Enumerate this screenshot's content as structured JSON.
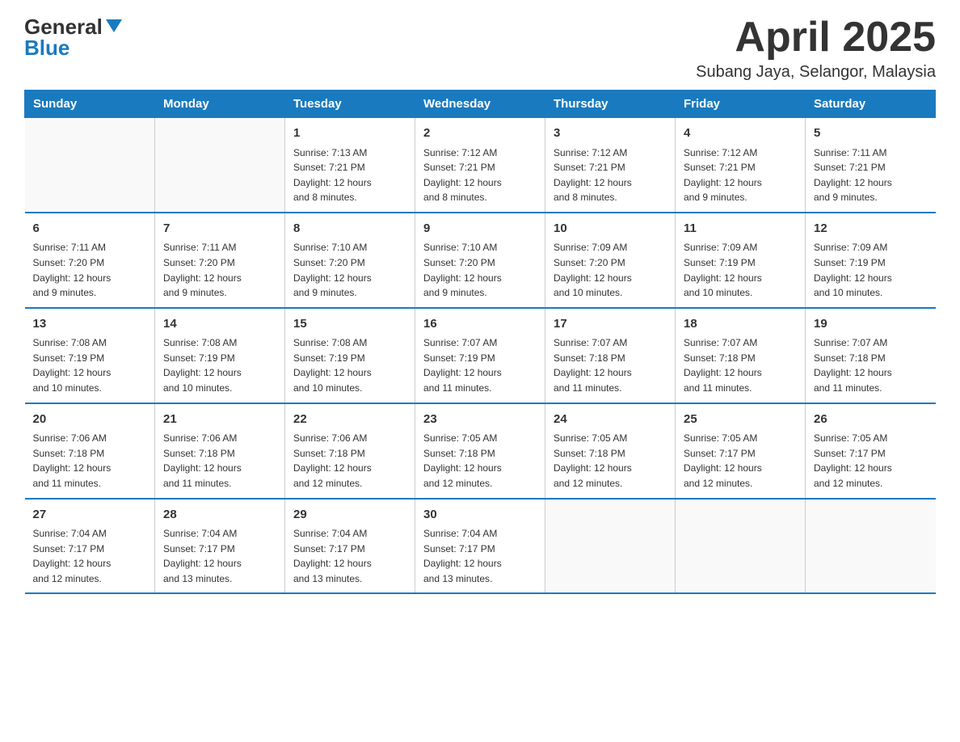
{
  "header": {
    "logo_general": "General",
    "logo_blue": "Blue",
    "month_title": "April 2025",
    "location": "Subang Jaya, Selangor, Malaysia"
  },
  "weekdays": [
    "Sunday",
    "Monday",
    "Tuesday",
    "Wednesday",
    "Thursday",
    "Friday",
    "Saturday"
  ],
  "weeks": [
    [
      {
        "day": "",
        "info": ""
      },
      {
        "day": "",
        "info": ""
      },
      {
        "day": "1",
        "info": "Sunrise: 7:13 AM\nSunset: 7:21 PM\nDaylight: 12 hours\nand 8 minutes."
      },
      {
        "day": "2",
        "info": "Sunrise: 7:12 AM\nSunset: 7:21 PM\nDaylight: 12 hours\nand 8 minutes."
      },
      {
        "day": "3",
        "info": "Sunrise: 7:12 AM\nSunset: 7:21 PM\nDaylight: 12 hours\nand 8 minutes."
      },
      {
        "day": "4",
        "info": "Sunrise: 7:12 AM\nSunset: 7:21 PM\nDaylight: 12 hours\nand 9 minutes."
      },
      {
        "day": "5",
        "info": "Sunrise: 7:11 AM\nSunset: 7:21 PM\nDaylight: 12 hours\nand 9 minutes."
      }
    ],
    [
      {
        "day": "6",
        "info": "Sunrise: 7:11 AM\nSunset: 7:20 PM\nDaylight: 12 hours\nand 9 minutes."
      },
      {
        "day": "7",
        "info": "Sunrise: 7:11 AM\nSunset: 7:20 PM\nDaylight: 12 hours\nand 9 minutes."
      },
      {
        "day": "8",
        "info": "Sunrise: 7:10 AM\nSunset: 7:20 PM\nDaylight: 12 hours\nand 9 minutes."
      },
      {
        "day": "9",
        "info": "Sunrise: 7:10 AM\nSunset: 7:20 PM\nDaylight: 12 hours\nand 9 minutes."
      },
      {
        "day": "10",
        "info": "Sunrise: 7:09 AM\nSunset: 7:20 PM\nDaylight: 12 hours\nand 10 minutes."
      },
      {
        "day": "11",
        "info": "Sunrise: 7:09 AM\nSunset: 7:19 PM\nDaylight: 12 hours\nand 10 minutes."
      },
      {
        "day": "12",
        "info": "Sunrise: 7:09 AM\nSunset: 7:19 PM\nDaylight: 12 hours\nand 10 minutes."
      }
    ],
    [
      {
        "day": "13",
        "info": "Sunrise: 7:08 AM\nSunset: 7:19 PM\nDaylight: 12 hours\nand 10 minutes."
      },
      {
        "day": "14",
        "info": "Sunrise: 7:08 AM\nSunset: 7:19 PM\nDaylight: 12 hours\nand 10 minutes."
      },
      {
        "day": "15",
        "info": "Sunrise: 7:08 AM\nSunset: 7:19 PM\nDaylight: 12 hours\nand 10 minutes."
      },
      {
        "day": "16",
        "info": "Sunrise: 7:07 AM\nSunset: 7:19 PM\nDaylight: 12 hours\nand 11 minutes."
      },
      {
        "day": "17",
        "info": "Sunrise: 7:07 AM\nSunset: 7:18 PM\nDaylight: 12 hours\nand 11 minutes."
      },
      {
        "day": "18",
        "info": "Sunrise: 7:07 AM\nSunset: 7:18 PM\nDaylight: 12 hours\nand 11 minutes."
      },
      {
        "day": "19",
        "info": "Sunrise: 7:07 AM\nSunset: 7:18 PM\nDaylight: 12 hours\nand 11 minutes."
      }
    ],
    [
      {
        "day": "20",
        "info": "Sunrise: 7:06 AM\nSunset: 7:18 PM\nDaylight: 12 hours\nand 11 minutes."
      },
      {
        "day": "21",
        "info": "Sunrise: 7:06 AM\nSunset: 7:18 PM\nDaylight: 12 hours\nand 11 minutes."
      },
      {
        "day": "22",
        "info": "Sunrise: 7:06 AM\nSunset: 7:18 PM\nDaylight: 12 hours\nand 12 minutes."
      },
      {
        "day": "23",
        "info": "Sunrise: 7:05 AM\nSunset: 7:18 PM\nDaylight: 12 hours\nand 12 minutes."
      },
      {
        "day": "24",
        "info": "Sunrise: 7:05 AM\nSunset: 7:18 PM\nDaylight: 12 hours\nand 12 minutes."
      },
      {
        "day": "25",
        "info": "Sunrise: 7:05 AM\nSunset: 7:17 PM\nDaylight: 12 hours\nand 12 minutes."
      },
      {
        "day": "26",
        "info": "Sunrise: 7:05 AM\nSunset: 7:17 PM\nDaylight: 12 hours\nand 12 minutes."
      }
    ],
    [
      {
        "day": "27",
        "info": "Sunrise: 7:04 AM\nSunset: 7:17 PM\nDaylight: 12 hours\nand 12 minutes."
      },
      {
        "day": "28",
        "info": "Sunrise: 7:04 AM\nSunset: 7:17 PM\nDaylight: 12 hours\nand 13 minutes."
      },
      {
        "day": "29",
        "info": "Sunrise: 7:04 AM\nSunset: 7:17 PM\nDaylight: 12 hours\nand 13 minutes."
      },
      {
        "day": "30",
        "info": "Sunrise: 7:04 AM\nSunset: 7:17 PM\nDaylight: 12 hours\nand 13 minutes."
      },
      {
        "day": "",
        "info": ""
      },
      {
        "day": "",
        "info": ""
      },
      {
        "day": "",
        "info": ""
      }
    ]
  ]
}
